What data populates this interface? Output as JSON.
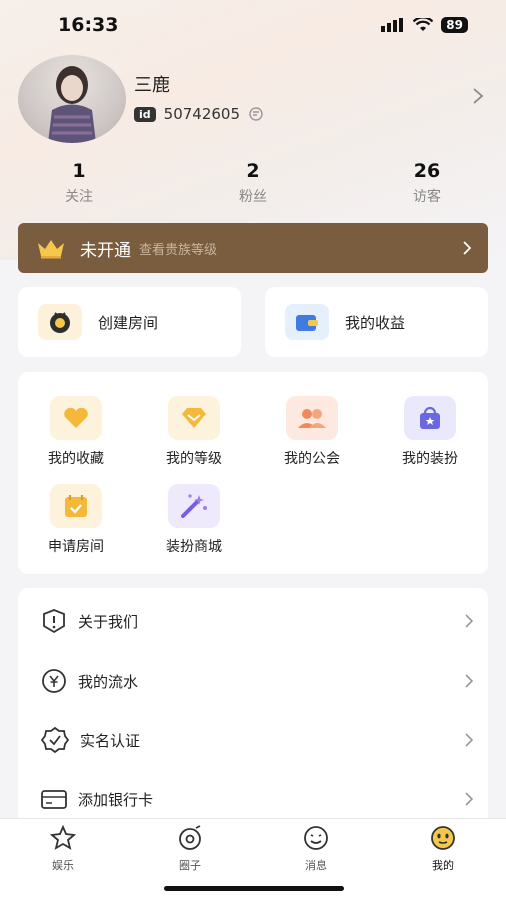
{
  "status_bar": {
    "time": "16:33",
    "battery": "89"
  },
  "profile": {
    "name": "三鹿",
    "id_tag": "id",
    "id_number": "50742605"
  },
  "stats": [
    {
      "num": "1",
      "label": "关注"
    },
    {
      "num": "2",
      "label": "粉丝"
    },
    {
      "num": "26",
      "label": "访客"
    }
  ],
  "vip": {
    "title": "未开通",
    "subtitle": "查看贵族等级"
  },
  "quick": [
    {
      "label": "创建房间",
      "icon": "tv-icon"
    },
    {
      "label": "我的收益",
      "icon": "wallet-icon"
    }
  ],
  "grid": [
    {
      "label": "我的收藏",
      "icon": "heart-icon"
    },
    {
      "label": "我的等级",
      "icon": "diamond-icon"
    },
    {
      "label": "我的公会",
      "icon": "group-icon"
    },
    {
      "label": "我的装扮",
      "icon": "bag-icon"
    },
    {
      "label": "申请房间",
      "icon": "calendar-icon"
    },
    {
      "label": "装扮商城",
      "icon": "magic-wand-icon"
    }
  ],
  "menu": [
    {
      "label": "关于我们",
      "icon": "info-icon"
    },
    {
      "label": "我的流水",
      "icon": "yuan-icon"
    },
    {
      "label": "实名认证",
      "icon": "verified-icon"
    },
    {
      "label": "添加银行卡",
      "icon": "card-icon"
    }
  ],
  "tabs": [
    {
      "label": "娱乐",
      "icon": "star-icon"
    },
    {
      "label": "圈子",
      "icon": "circle-icon"
    },
    {
      "label": "消息",
      "icon": "message-face-icon"
    },
    {
      "label": "我的",
      "icon": "smile-face-icon"
    }
  ],
  "colors": {
    "vip_bg": "#7a5c3f",
    "accent": "#f5c84c"
  }
}
